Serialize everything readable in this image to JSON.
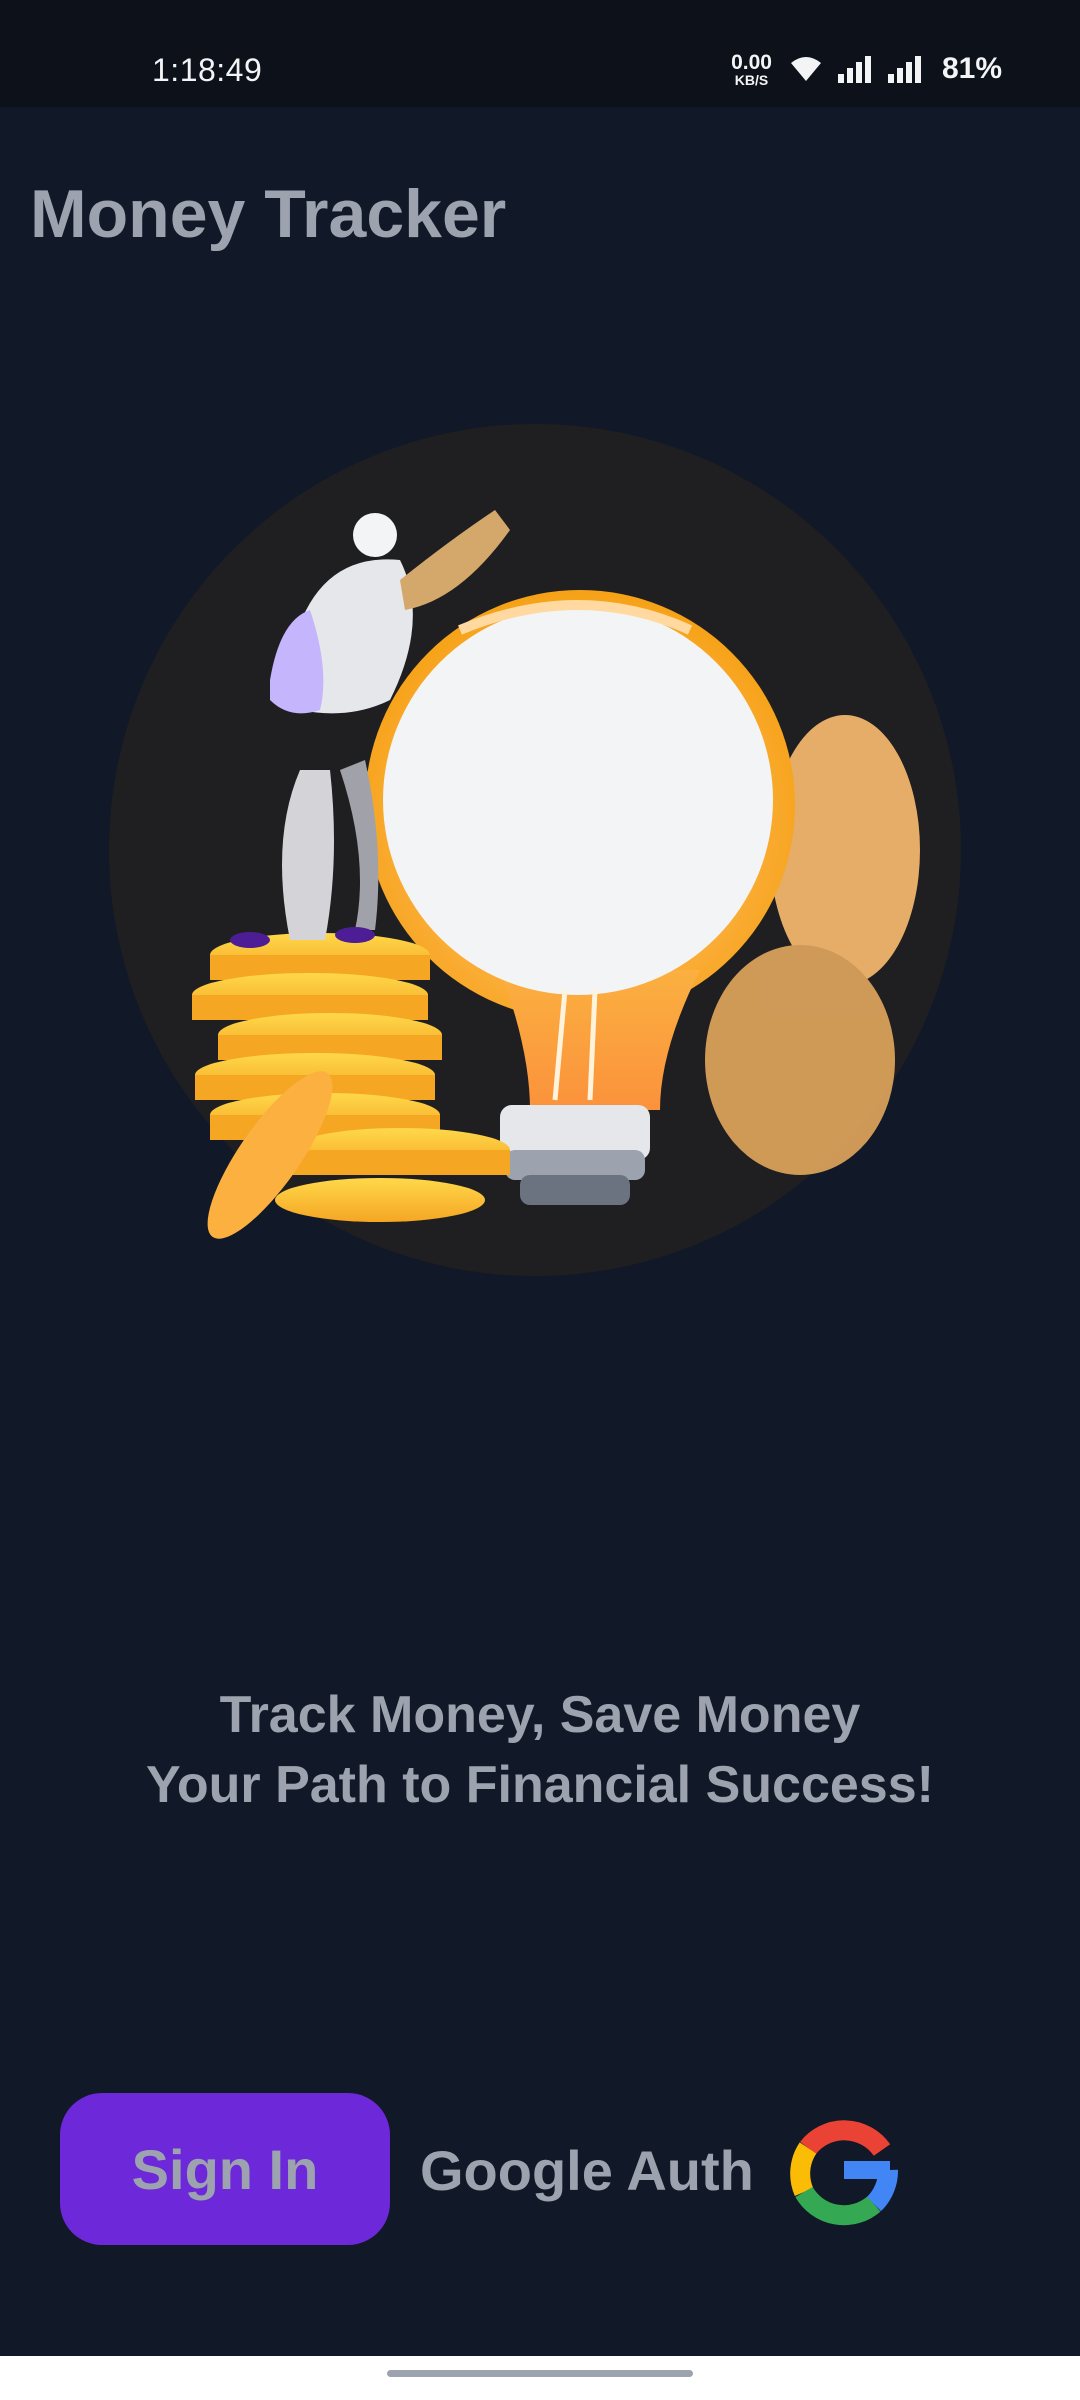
{
  "status_bar": {
    "time": "1:18:49",
    "net_speed_value": "0.00",
    "net_speed_unit": "KB/S",
    "battery": "81%",
    "icons": [
      "wifi-icon",
      "signal-icon",
      "signal-icon"
    ]
  },
  "app": {
    "title": "Money Tracker"
  },
  "hero": {
    "tagline_line1": "Track Money, Save Money",
    "tagline_line2": "Your Path to Financial Success!"
  },
  "actions": {
    "signin_label": "Sign In",
    "google_label": "Google Auth",
    "google_icon": "google-icon"
  },
  "colors": {
    "background": "#111827",
    "text_muted": "#9ca3af",
    "accent": "#6d28d9"
  }
}
